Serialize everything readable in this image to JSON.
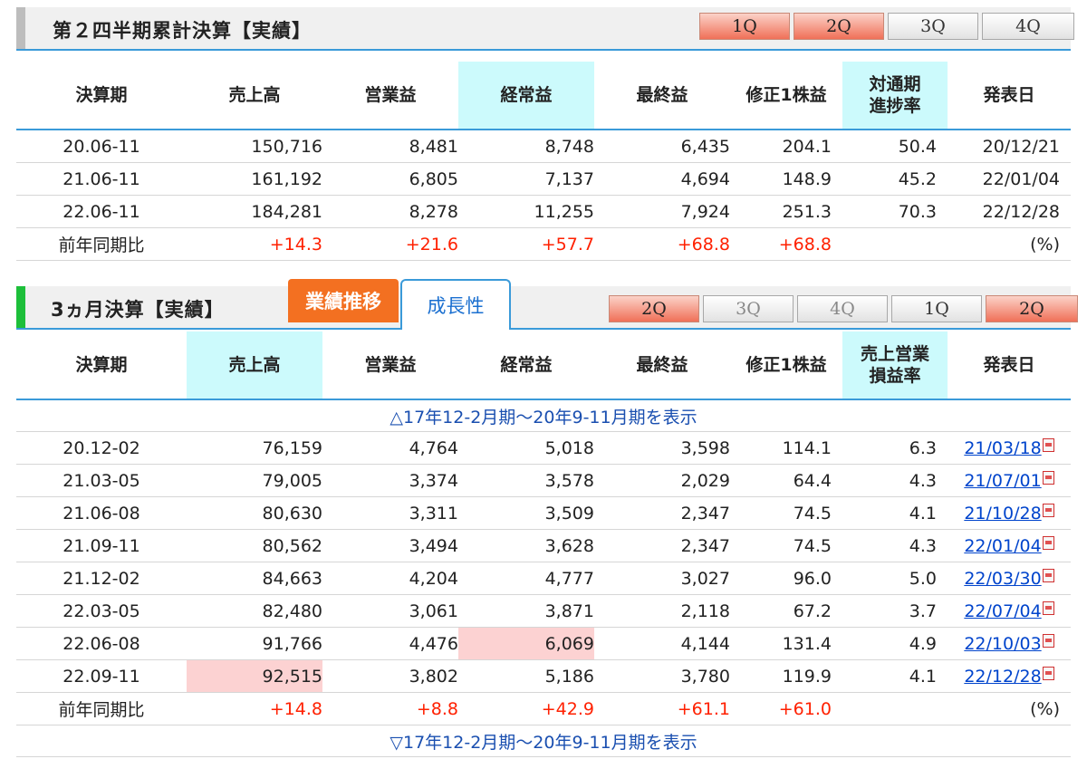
{
  "cumulative": {
    "title": "第２四半期累計決算【実績】",
    "quarters": [
      {
        "label": "1Q",
        "state": "active"
      },
      {
        "label": "2Q",
        "state": "active"
      },
      {
        "label": "3Q",
        "state": "normal"
      },
      {
        "label": "4Q",
        "state": "normal"
      }
    ],
    "headers": [
      "決算期",
      "売上高",
      "営業益",
      "経常益",
      "最終益",
      "修正1株益",
      "対通期進捗率",
      "発表日"
    ],
    "progress_header": {
      "line1": "対通期",
      "line2": "進捗率"
    },
    "rows": [
      [
        "20.06-11",
        "150,716",
        "8,481",
        "8,748",
        "6,435",
        "204.1",
        "50.4",
        "20/12/21"
      ],
      [
        "21.06-11",
        "161,192",
        "6,805",
        "7,137",
        "4,694",
        "148.9",
        "45.2",
        "22/01/04"
      ],
      [
        "22.06-11",
        "184,281",
        "8,278",
        "11,255",
        "7,924",
        "251.3",
        "70.3",
        "22/12/28"
      ]
    ],
    "yoy": {
      "label": "前年同期比",
      "values": [
        "+14.3",
        "+21.6",
        "+57.7",
        "+68.8",
        "+68.8"
      ],
      "unit": "(%)"
    }
  },
  "quarterly": {
    "title": "3ヵ月決算【実績】",
    "tabs": [
      {
        "label": "業績推移"
      },
      {
        "label": "成長性"
      }
    ],
    "quarters": [
      {
        "label": "2Q",
        "state": "active"
      },
      {
        "label": "3Q",
        "state": "dim"
      },
      {
        "label": "4Q",
        "state": "dim"
      },
      {
        "label": "1Q",
        "state": "normal"
      },
      {
        "label": "2Q",
        "state": "active"
      }
    ],
    "headers": [
      "決算期",
      "売上高",
      "営業益",
      "経常益",
      "最終益",
      "修正1株益",
      "売上営業損益率",
      "発表日"
    ],
    "margin_header": {
      "line1": "売上営業",
      "line2": "損益率"
    },
    "show_prev": "△17年12-2月期～20年9-11月期を表示",
    "show_next": "▽17年12-2月期～20年9-11月期を表示",
    "rows": [
      [
        "20.12-02",
        "76,159",
        "4,764",
        "5,018",
        "3,598",
        "114.1",
        "6.3",
        "21/03/18"
      ],
      [
        "21.03-05",
        "79,005",
        "3,374",
        "3,578",
        "2,029",
        "64.4",
        "4.3",
        "21/07/01"
      ],
      [
        "21.06-08",
        "80,630",
        "3,311",
        "3,509",
        "2,347",
        "74.5",
        "4.1",
        "21/10/28"
      ],
      [
        "21.09-11",
        "80,562",
        "3,494",
        "3,628",
        "2,347",
        "74.5",
        "4.3",
        "22/01/04"
      ],
      [
        "21.12-02",
        "84,663",
        "4,204",
        "4,777",
        "3,027",
        "96.0",
        "5.0",
        "22/03/30"
      ],
      [
        "22.03-05",
        "82,480",
        "3,061",
        "3,871",
        "2,118",
        "67.2",
        "3.7",
        "22/07/04"
      ],
      [
        "22.06-08",
        "91,766",
        "4,476",
        "6,069",
        "4,144",
        "131.4",
        "4.9",
        "22/10/03"
      ],
      [
        "22.09-11",
        "92,515",
        "3,802",
        "5,186",
        "3,780",
        "119.9",
        "4.1",
        "22/12/28"
      ]
    ],
    "yoy": {
      "label": "前年同期比",
      "values": [
        "+14.8",
        "+8.8",
        "+42.9",
        "+61.1",
        "+61.0"
      ],
      "unit": "(%)"
    }
  },
  "colors": {
    "accent_blue": "#3a9ad9",
    "header_highlight": "#ccfafc",
    "positive": "#ff2000",
    "peak": "#fcd2d2",
    "tab_orange": "#f37021",
    "bar_gray": "#bdbdbd",
    "bar_green": "#1dbf3a"
  }
}
